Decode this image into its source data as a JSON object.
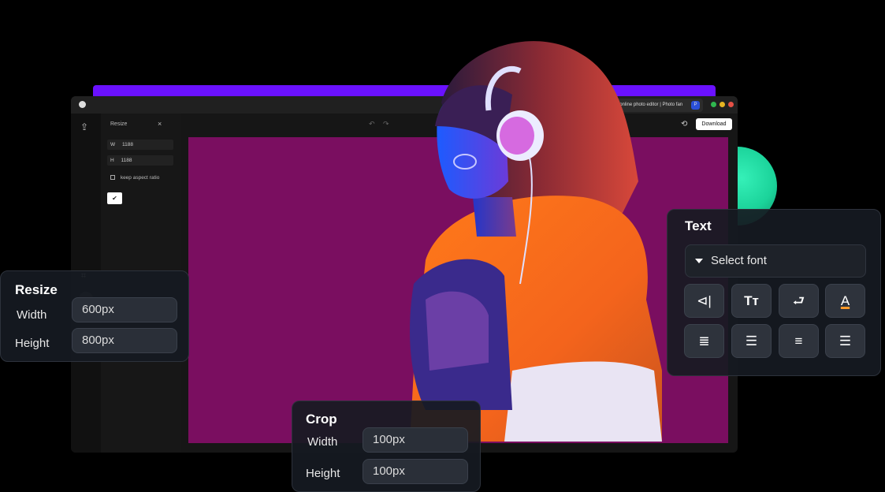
{
  "browser": {
    "tab_title": "online photo editor | Photo fan",
    "tab_close": "×",
    "tab_badge": "P"
  },
  "editor": {
    "panel_title": "Resize",
    "panel_close": "×",
    "width_label": "W",
    "width_value": "1188",
    "height_label": "H",
    "height_value": "1188",
    "aspect_label": "keep aspect ratio",
    "apply_icon": "✔",
    "download_label": "Download",
    "undo_icon": "↶",
    "redo_icon": "↷",
    "history_icon": "⟲",
    "upload_icon": "⇪",
    "crop_icon": "⌗"
  },
  "resize_card": {
    "title": "Resize",
    "width_label": "Width",
    "width_value": "600px",
    "height_label": "Height",
    "height_value": "800px"
  },
  "crop_card": {
    "title": "Crop",
    "width_label": "Width",
    "width_value": "100px",
    "height_label": "Height",
    "height_value": "100px"
  },
  "text_card": {
    "title": "Text",
    "font_placeholder": "Select font",
    "tools": [
      {
        "icon": "text-direction-icon",
        "glyph": "⊲|"
      },
      {
        "icon": "text-size-icon",
        "glyph": "Tт"
      },
      {
        "icon": "text-wrap-icon",
        "glyph": "⮐"
      },
      {
        "icon": "text-color-icon",
        "glyph": "A"
      },
      {
        "icon": "align-justify-icon",
        "glyph": "≣"
      },
      {
        "icon": "align-left-icon",
        "glyph": "☰"
      },
      {
        "icon": "align-center-icon",
        "glyph": "≡"
      },
      {
        "icon": "align-right-icon",
        "glyph": "☰"
      }
    ]
  },
  "colors": {
    "accent_purple": "#6a11ff",
    "canvas_bg": "#7a0e60",
    "accent_green": "#1bd39a"
  }
}
